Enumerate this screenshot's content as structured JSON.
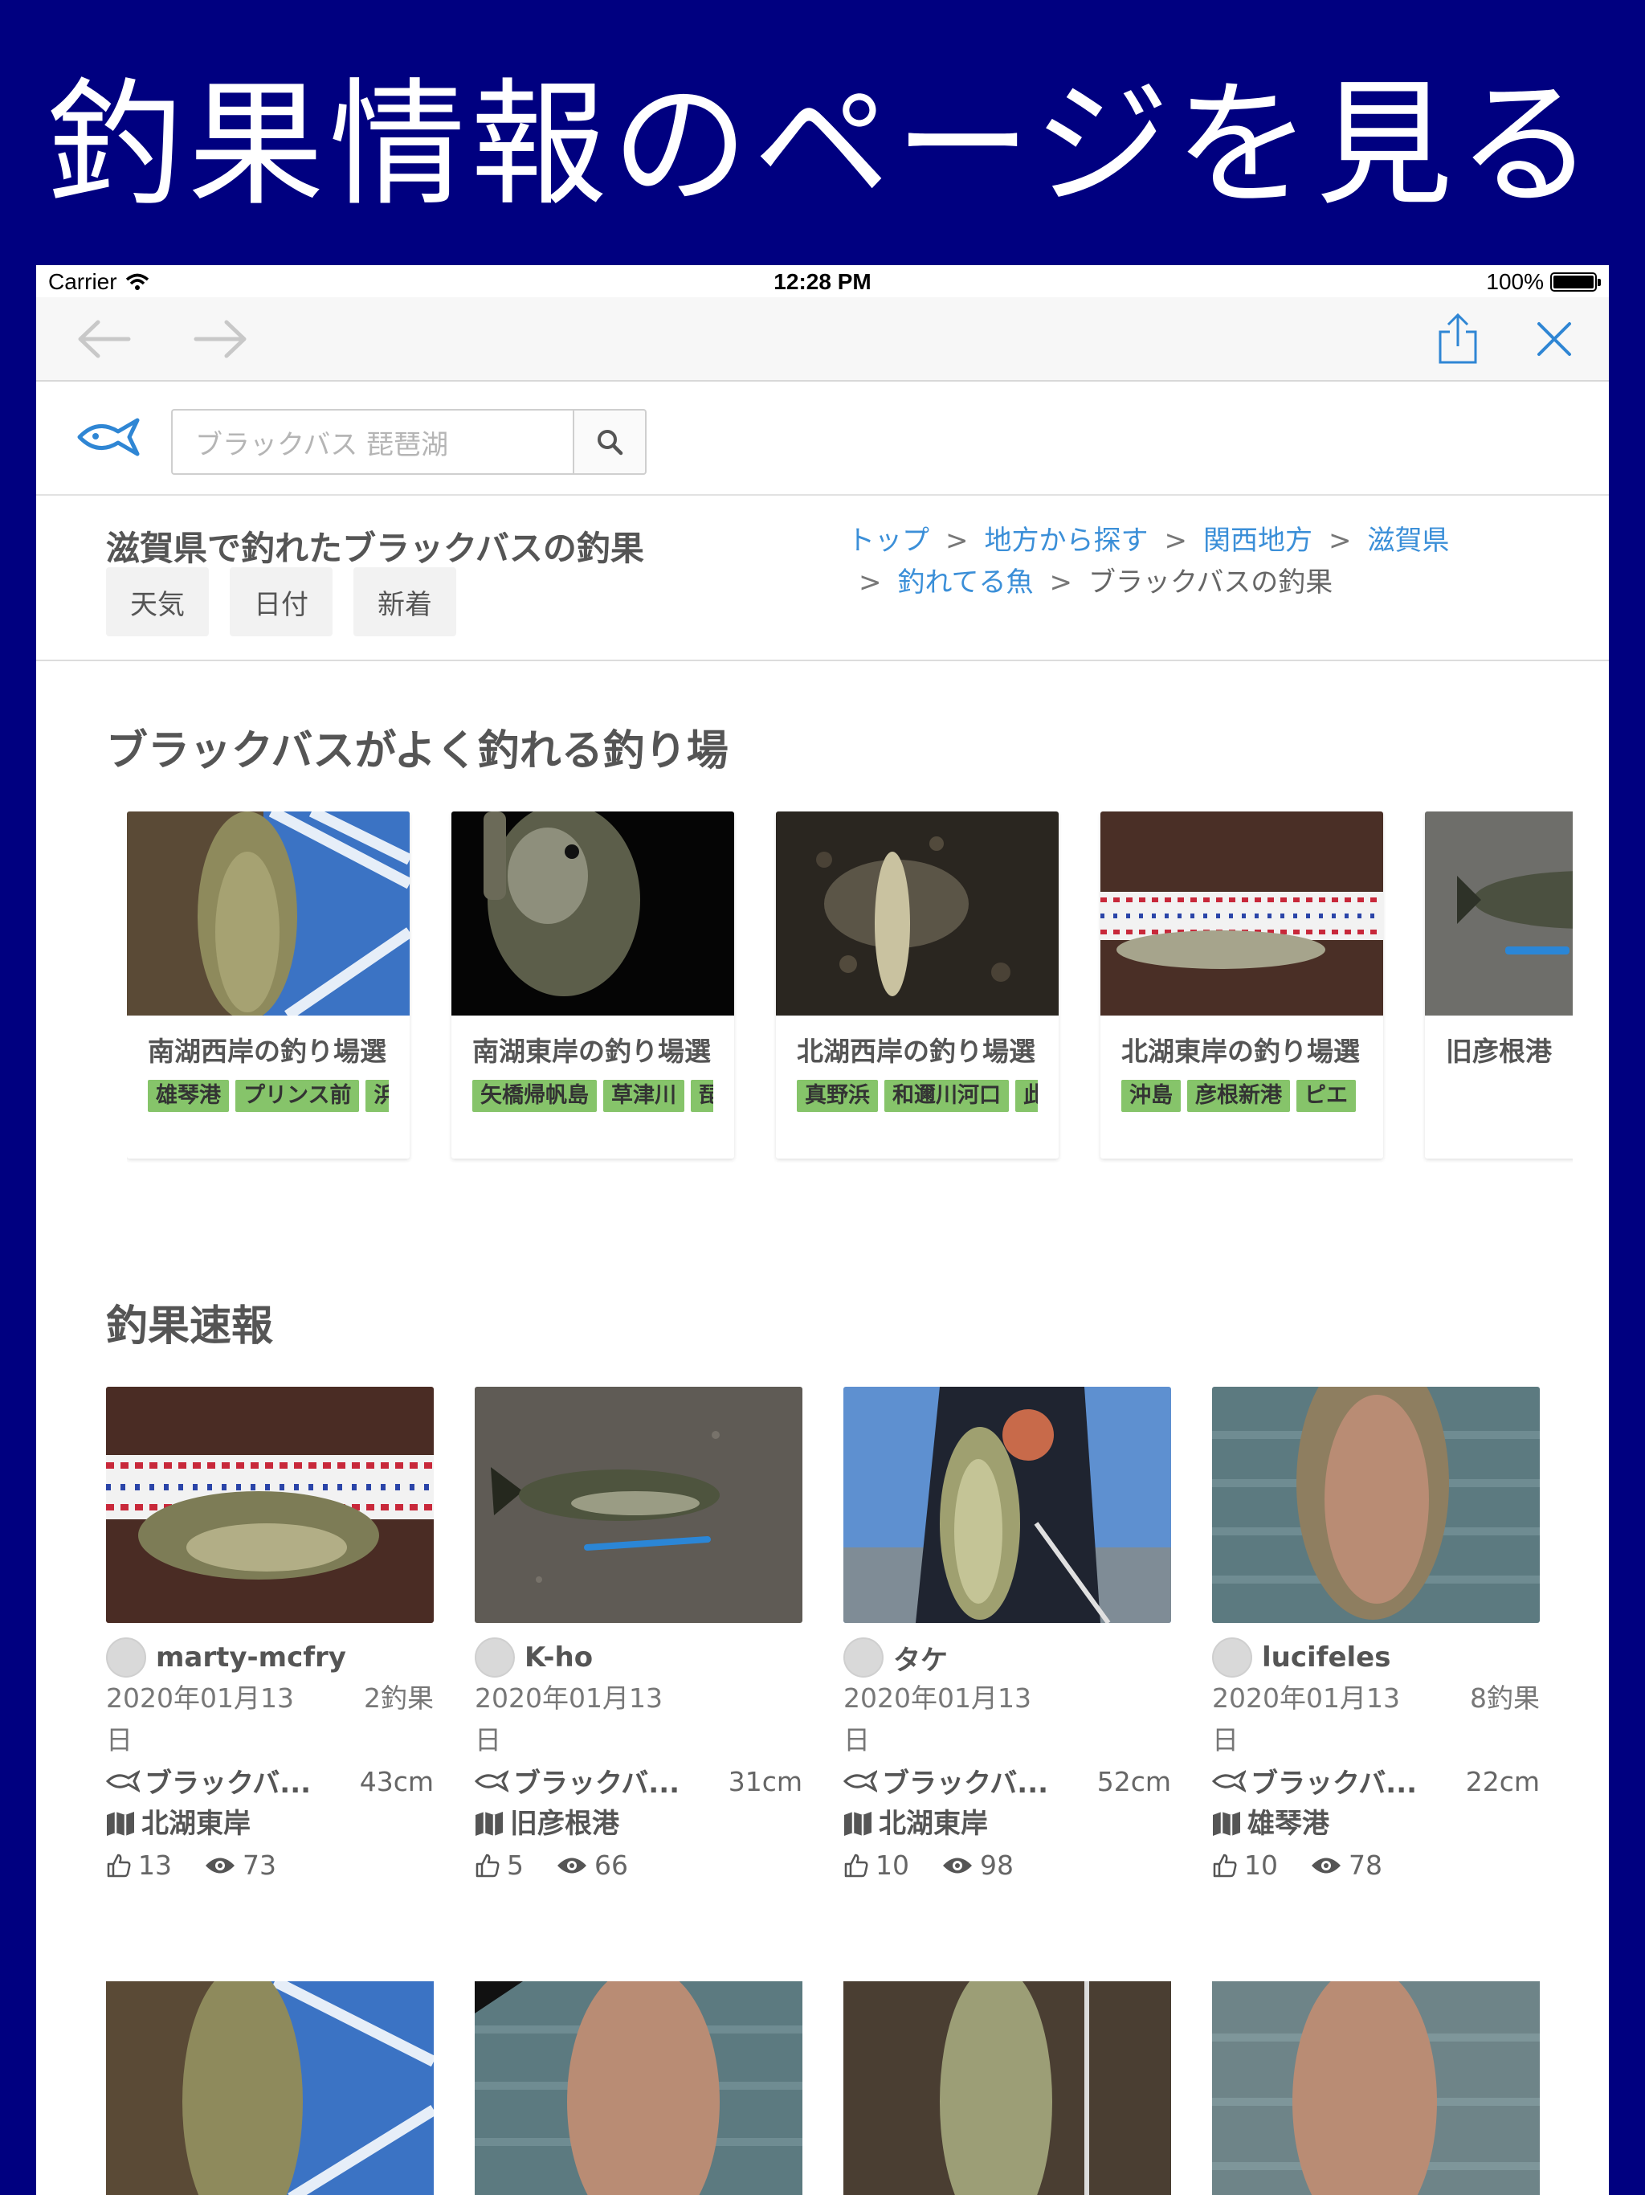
{
  "promo": {
    "title": "釣果情報のページを見る"
  },
  "status_bar": {
    "carrier": "Carrier",
    "time": "12:28 PM",
    "battery": "100%",
    "battery_level": 1.0
  },
  "browser": {
    "back_icon": "arrow-left-icon",
    "forward_icon": "arrow-right-icon",
    "share_icon": "share-icon",
    "close_icon": "close-icon"
  },
  "header": {
    "logo_icon": "fish-logo-icon",
    "search_placeholder": "ブラックバス 琵琶湖",
    "search_icon": "search-icon"
  },
  "page": {
    "title": "滋賀県で釣れたブラックバスの釣果",
    "chips": [
      "天気",
      "日付",
      "新着"
    ],
    "breadcrumb": {
      "links": [
        "トップ",
        "地方から探す",
        "関西地方",
        "滋賀県",
        "釣れてる魚"
      ],
      "current": "ブラックバスの釣果",
      "separator": ">"
    }
  },
  "spots_section": {
    "title": "ブラックバスがよく釣れる釣り場",
    "spots": [
      {
        "name": "南湖西岸の釣り場選",
        "tags": [
          "雄琴港",
          "プリンス前",
          "浜"
        ]
      },
      {
        "name": "南湖東岸の釣り場選",
        "tags": [
          "矢橋帰帆島",
          "草津川",
          "琵"
        ]
      },
      {
        "name": "北湖西岸の釣り場選",
        "tags": [
          "真野浜",
          "和邇川河口",
          "此"
        ]
      },
      {
        "name": "北湖東岸の釣り場選",
        "tags": [
          "沖島",
          "彦根新港",
          "ピエ"
        ]
      },
      {
        "name": "旧彦根港",
        "tags": []
      }
    ]
  },
  "catches_section": {
    "title": "釣果速報",
    "catches": [
      {
        "user": "marty-mcfry",
        "date": "2020年01月13日",
        "count": "2釣果",
        "fish": "ブラックバ...",
        "size": "43cm",
        "spot": "北湖東岸",
        "likes": "13",
        "views": "73"
      },
      {
        "user": "K-ho",
        "date": "2020年01月13日",
        "count": "",
        "fish": "ブラックバ...",
        "size": "31cm",
        "spot": "旧彦根港",
        "likes": "5",
        "views": "66"
      },
      {
        "user": "タケ",
        "date": "2020年01月13日",
        "count": "",
        "fish": "ブラックバ...",
        "size": "52cm",
        "spot": "北湖東岸",
        "likes": "10",
        "views": "98"
      },
      {
        "user": "lucifeles",
        "date": "2020年01月13日",
        "count": "8釣果",
        "fish": "ブラックバ...",
        "size": "22cm",
        "spot": "雄琴港",
        "likes": "10",
        "views": "78"
      }
    ]
  },
  "colors": {
    "background": "#000080",
    "link": "#3b8fd8",
    "tag": "#86c46a",
    "icon_blue": "#2f86d4"
  }
}
